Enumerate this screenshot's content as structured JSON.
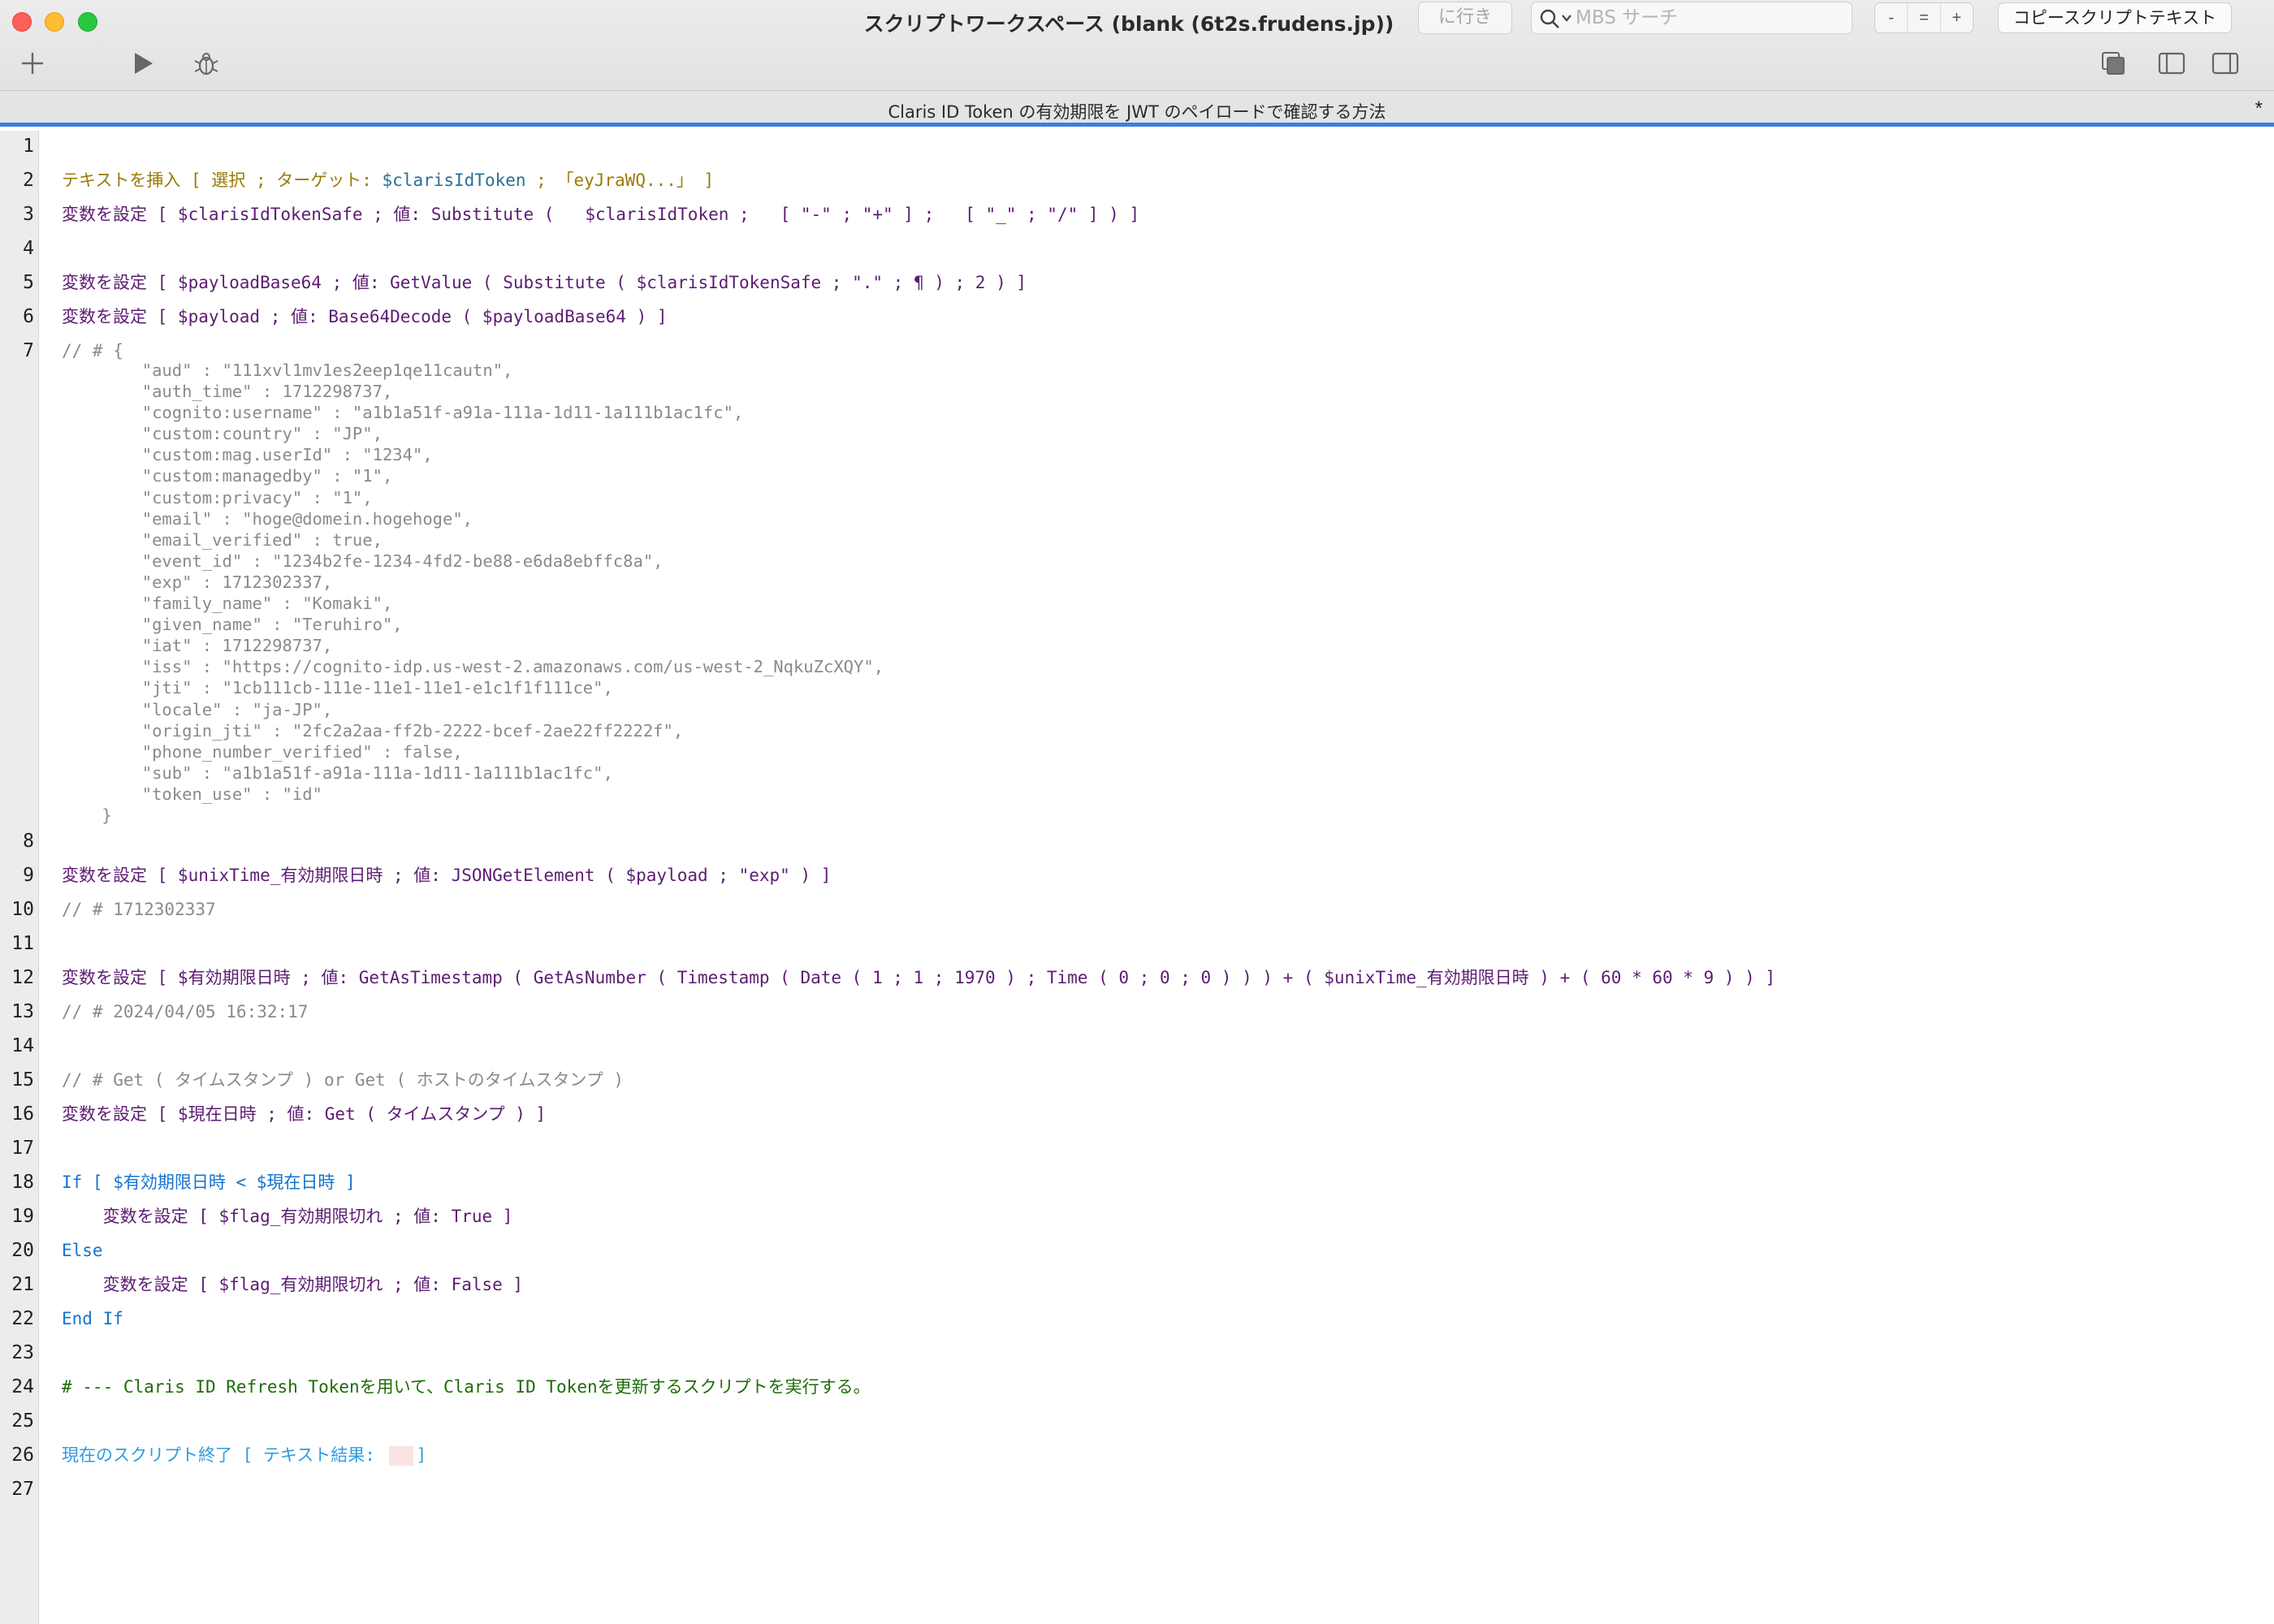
{
  "window": {
    "title": "スクリプトワークスペース (blank (6t2s.frudens.jp))",
    "goto_label": "に行き",
    "search_placeholder": "MBS サーチ",
    "zoom_minus": "-",
    "zoom_reset": "=",
    "zoom_plus": "+",
    "copy_label": "コピースクリプトテキスト"
  },
  "toolbar_icons": [
    "plus-icon",
    "run-icon",
    "debug-bug-icon",
    "copy-icon",
    "left-panel-icon",
    "right-panel-icon"
  ],
  "script": {
    "name": "Claris ID Token の有効期限を JWT のペイロードで確認する方法",
    "modified_marker": "*"
  },
  "line_numbers": [
    "1",
    "2",
    "3",
    "4",
    "5",
    "6",
    "7",
    "8",
    "9",
    "10",
    "11",
    "12",
    "13",
    "14",
    "15",
    "16",
    "17",
    "18",
    "19",
    "20",
    "21",
    "22",
    "23",
    "24",
    "25",
    "26",
    "27"
  ],
  "code": {
    "l2": "テキストを挿入 [ 選択 ; ターゲット: ",
    "l2_var": "$clarisIdToken",
    "l2_tail": " ; 「eyJraWQ...」 ]",
    "l3": "変数を設定 [ $clarisIdTokenSafe ; 値: Substitute (   $clarisIdToken ;   [ \"-\" ; \"+\" ] ;   [ \"_\" ; \"/\" ] ) ]",
    "l5": "変数を設定 [ $payloadBase64 ; 値: GetValue ( Substitute ( $clarisIdTokenSafe ; \".\" ; ¶ ) ; 2 ) ]",
    "l6": "変数を設定 [ $payload ; 値: Base64Decode ( $payloadBase64 ) ]",
    "l7": "// # {",
    "json_lines": [
      "        \"aud\" : \"111xvl1mv1es2eep1qe11cautn\",",
      "        \"auth_time\" : 1712298737,",
      "        \"cognito:username\" : \"a1b1a51f-a91a-111a-1d11-1a111b1ac1fc\",",
      "        \"custom:country\" : \"JP\",",
      "        \"custom:mag.userId\" : \"1234\",",
      "        \"custom:managedby\" : \"1\",",
      "        \"custom:privacy\" : \"1\",",
      "        \"email\" : \"hoge@domein.hogehoge\",",
      "        \"email_verified\" : true,",
      "        \"event_id\" : \"1234b2fe-1234-4fd2-be88-e6da8ebffc8a\",",
      "        \"exp\" : 1712302337,",
      "        \"family_name\" : \"Komaki\",",
      "        \"given_name\" : \"Teruhiro\",",
      "        \"iat\" : 1712298737,",
      "        \"iss\" : \"https://cognito-idp.us-west-2.amazonaws.com/us-west-2_NqkuZcXQY\",",
      "        \"jti\" : \"1cb111cb-111e-11e1-11e1-e1c1f1f111ce\",",
      "        \"locale\" : \"ja-JP\",",
      "        \"origin_jti\" : \"2fc2a2aa-ff2b-2222-bcef-2ae22ff2222f\",",
      "        \"phone_number_verified\" : false,",
      "        \"sub\" : \"a1b1a51f-a91a-111a-1d11-1a111b1ac1fc\",",
      "        \"token_use\" : \"id\"",
      "    }"
    ],
    "l9": "変数を設定 [ $unixTime_有効期限日時 ; 値: JSONGetElement ( $payload ; \"exp\" ) ]",
    "l10": "// # 1712302337",
    "l12": "変数を設定 [ $有効期限日時 ; 値: GetAsTimestamp ( GetAsNumber ( Timestamp ( Date ( 1 ; 1 ; 1970 ) ; Time ( 0 ; 0 ; 0 ) ) ) + ( $unixTime_有効期限日時 ) + ( 60 * 60 * 9 ) ) ]",
    "l13": "// # 2024/04/05 16:32:17",
    "l15": "// # Get ( タイムスタンプ ) or Get ( ホストのタイムスタンプ )",
    "l16": "変数を設定 [ $現在日時 ; 値: Get ( タイムスタンプ ) ]",
    "l18": "If [ $有効期限日時 < $現在日時 ]",
    "l19": "    変数を設定 [ $flag_有効期限切れ ; 値: True ]",
    "l20": "Else",
    "l21": "    変数を設定 [ $flag_有効期限切れ ; 値: False ]",
    "l22": "End If",
    "l24": "# --- Claris ID Refresh Tokenを用いて、Claris ID Tokenを更新するスクリプトを実行する。",
    "l26_head": "現在のスクリプト終了 [ テキスト結果: ",
    "l26_tail": "]"
  },
  "colors": {
    "script_step": "#5d1c72",
    "insert_text_step": "#9b7b05",
    "comment": "#8a8a8a",
    "control": "#1473d0",
    "green_comment": "#1d6d06",
    "exit_step": "#2f9be0",
    "accent": "#3a7ee8"
  }
}
